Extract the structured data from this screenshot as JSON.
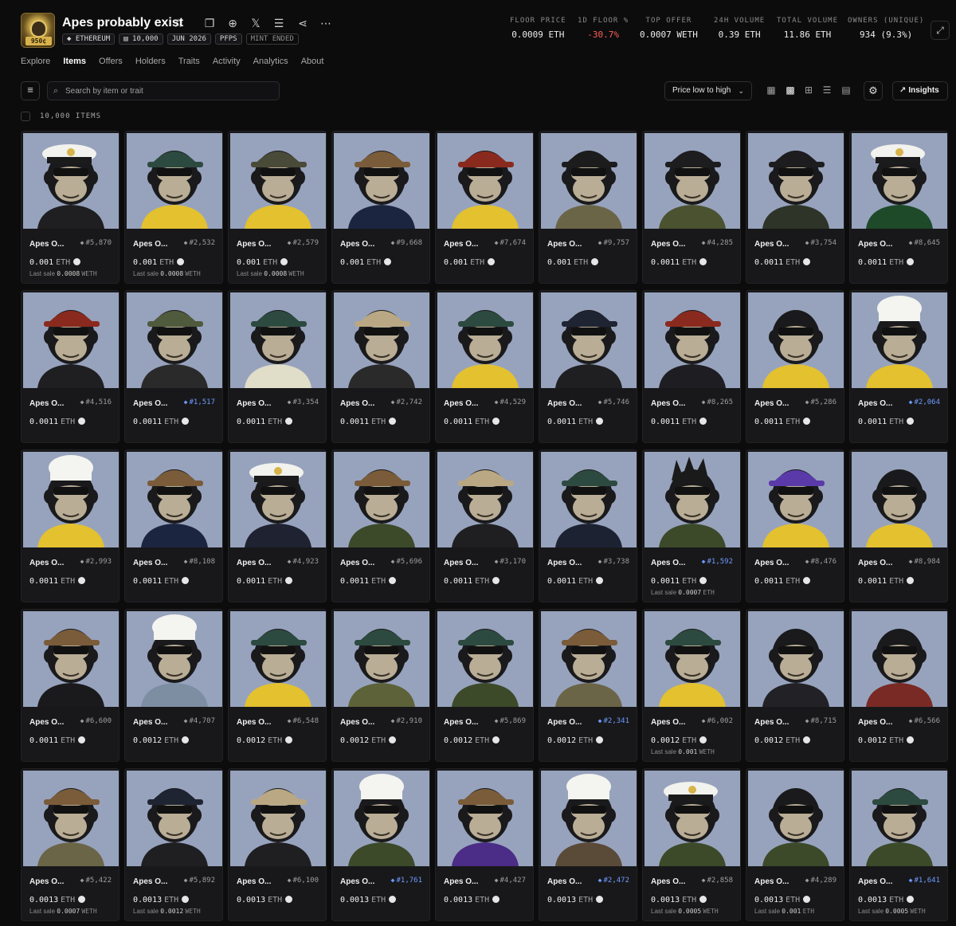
{
  "collection": {
    "name": "Apes probably exist",
    "logo_badge": "950¢",
    "tags": [
      "ETHEREUM",
      "10,000",
      "JUN 2026",
      "PFPS",
      "MINT ENDED"
    ]
  },
  "stats": [
    {
      "label": "FLOOR PRICE",
      "value": "0.0009 ETH",
      "negative": false
    },
    {
      "label": "1D FLOOR %",
      "value": "-30.7%",
      "negative": true
    },
    {
      "label": "TOP OFFER",
      "value": "0.0007 WETH",
      "negative": false
    },
    {
      "label": "24H VOLUME",
      "value": "0.39 ETH",
      "negative": false
    },
    {
      "label": "TOTAL VOLUME",
      "value": "11.86 ETH",
      "negative": false
    },
    {
      "label": "OWNERS (UNIQUE)",
      "value": "934 (9.3%)",
      "negative": false
    }
  ],
  "nav": [
    "Explore",
    "Items",
    "Offers",
    "Holders",
    "Traits",
    "Activity",
    "Analytics",
    "About"
  ],
  "nav_active": "Items",
  "search": {
    "placeholder": "Search by item or trait"
  },
  "sort": {
    "label": "Price low to high"
  },
  "insights": {
    "label": "Insights"
  },
  "items_count": "10,000 ITEMS",
  "colors": {
    "art_bg": "#97a3bd",
    "accent_blue": "#6e9bff",
    "negative": "#ff5f57"
  },
  "items": [
    {
      "name": "Apes O...",
      "token": "#5,870",
      "blue": false,
      "price": "0.001",
      "currency": "ETH",
      "last_sale": "0.0008",
      "last_cur": "WETH"
    },
    {
      "name": "Apes O...",
      "token": "#2,532",
      "blue": false,
      "price": "0.001",
      "currency": "ETH",
      "last_sale": "0.0008",
      "last_cur": "WETH"
    },
    {
      "name": "Apes O...",
      "token": "#2,579",
      "blue": false,
      "price": "0.001",
      "currency": "ETH",
      "last_sale": "0.0008",
      "last_cur": "WETH"
    },
    {
      "name": "Apes O...",
      "token": "#9,668",
      "blue": false,
      "price": "0.001",
      "currency": "ETH",
      "last_sale": "",
      "last_cur": ""
    },
    {
      "name": "Apes O...",
      "token": "#7,674",
      "blue": false,
      "price": "0.001",
      "currency": "ETH",
      "last_sale": "",
      "last_cur": ""
    },
    {
      "name": "Apes O...",
      "token": "#9,757",
      "blue": false,
      "price": "0.001",
      "currency": "ETH",
      "last_sale": "",
      "last_cur": ""
    },
    {
      "name": "Apes O...",
      "token": "#4,285",
      "blue": false,
      "price": "0.0011",
      "currency": "ETH",
      "last_sale": "",
      "last_cur": ""
    },
    {
      "name": "Apes O...",
      "token": "#3,754",
      "blue": false,
      "price": "0.0011",
      "currency": "ETH",
      "last_sale": "",
      "last_cur": ""
    },
    {
      "name": "Apes O...",
      "token": "#8,645",
      "blue": false,
      "price": "0.0011",
      "currency": "ETH",
      "last_sale": "",
      "last_cur": ""
    },
    {
      "name": "Apes O...",
      "token": "#4,516",
      "blue": false,
      "price": "0.0011",
      "currency": "ETH",
      "last_sale": "",
      "last_cur": ""
    },
    {
      "name": "Apes O...",
      "token": "#1,517",
      "blue": true,
      "price": "0.0011",
      "currency": "ETH",
      "last_sale": "",
      "last_cur": ""
    },
    {
      "name": "Apes O...",
      "token": "#3,354",
      "blue": false,
      "price": "0.0011",
      "currency": "ETH",
      "last_sale": "",
      "last_cur": ""
    },
    {
      "name": "Apes O...",
      "token": "#2,742",
      "blue": false,
      "price": "0.0011",
      "currency": "ETH",
      "last_sale": "",
      "last_cur": ""
    },
    {
      "name": "Apes O...",
      "token": "#4,529",
      "blue": false,
      "price": "0.0011",
      "currency": "ETH",
      "last_sale": "",
      "last_cur": ""
    },
    {
      "name": "Apes O...",
      "token": "#5,746",
      "blue": false,
      "price": "0.0011",
      "currency": "ETH",
      "last_sale": "",
      "last_cur": ""
    },
    {
      "name": "Apes O...",
      "token": "#8,265",
      "blue": false,
      "price": "0.0011",
      "currency": "ETH",
      "last_sale": "",
      "last_cur": ""
    },
    {
      "name": "Apes O...",
      "token": "#5,286",
      "blue": false,
      "price": "0.0011",
      "currency": "ETH",
      "last_sale": "",
      "last_cur": ""
    },
    {
      "name": "Apes O...",
      "token": "#2,064",
      "blue": true,
      "price": "0.0011",
      "currency": "ETH",
      "last_sale": "",
      "last_cur": ""
    },
    {
      "name": "Apes O...",
      "token": "#2,993",
      "blue": false,
      "price": "0.0011",
      "currency": "ETH",
      "last_sale": "",
      "last_cur": ""
    },
    {
      "name": "Apes O...",
      "token": "#8,108",
      "blue": false,
      "price": "0.0011",
      "currency": "ETH",
      "last_sale": "",
      "last_cur": ""
    },
    {
      "name": "Apes O...",
      "token": "#4,923",
      "blue": false,
      "price": "0.0011",
      "currency": "ETH",
      "last_sale": "",
      "last_cur": ""
    },
    {
      "name": "Apes O...",
      "token": "#5,696",
      "blue": false,
      "price": "0.0011",
      "currency": "ETH",
      "last_sale": "",
      "last_cur": ""
    },
    {
      "name": "Apes O...",
      "token": "#3,170",
      "blue": false,
      "price": "0.0011",
      "currency": "ETH",
      "last_sale": "",
      "last_cur": ""
    },
    {
      "name": "Apes O...",
      "token": "#3,738",
      "blue": false,
      "price": "0.0011",
      "currency": "ETH",
      "last_sale": "",
      "last_cur": ""
    },
    {
      "name": "Apes O...",
      "token": "#1,592",
      "blue": true,
      "price": "0.0011",
      "currency": "ETH",
      "last_sale": "0.0007",
      "last_cur": "ETH"
    },
    {
      "name": "Apes O...",
      "token": "#8,476",
      "blue": false,
      "price": "0.0011",
      "currency": "ETH",
      "last_sale": "",
      "last_cur": ""
    },
    {
      "name": "Apes O...",
      "token": "#8,984",
      "blue": false,
      "price": "0.0011",
      "currency": "ETH",
      "last_sale": "",
      "last_cur": ""
    },
    {
      "name": "Apes O...",
      "token": "#6,600",
      "blue": false,
      "price": "0.0011",
      "currency": "ETH",
      "last_sale": "",
      "last_cur": ""
    },
    {
      "name": "Apes O...",
      "token": "#4,707",
      "blue": false,
      "price": "0.0012",
      "currency": "ETH",
      "last_sale": "",
      "last_cur": ""
    },
    {
      "name": "Apes O...",
      "token": "#6,548",
      "blue": false,
      "price": "0.0012",
      "currency": "ETH",
      "last_sale": "",
      "last_cur": ""
    },
    {
      "name": "Apes O...",
      "token": "#2,910",
      "blue": false,
      "price": "0.0012",
      "currency": "ETH",
      "last_sale": "",
      "last_cur": ""
    },
    {
      "name": "Apes O...",
      "token": "#5,869",
      "blue": false,
      "price": "0.0012",
      "currency": "ETH",
      "last_sale": "",
      "last_cur": ""
    },
    {
      "name": "Apes O...",
      "token": "#2,341",
      "blue": true,
      "price": "0.0012",
      "currency": "ETH",
      "last_sale": "",
      "last_cur": ""
    },
    {
      "name": "Apes O...",
      "token": "#6,002",
      "blue": false,
      "price": "0.0012",
      "currency": "ETH",
      "last_sale": "0.001",
      "last_cur": "WETH"
    },
    {
      "name": "Apes O...",
      "token": "#8,715",
      "blue": false,
      "price": "0.0012",
      "currency": "ETH",
      "last_sale": "",
      "last_cur": ""
    },
    {
      "name": "Apes O...",
      "token": "#6,566",
      "blue": false,
      "price": "0.0012",
      "currency": "ETH",
      "last_sale": "",
      "last_cur": ""
    },
    {
      "name": "Apes O...",
      "token": "#5,422",
      "blue": false,
      "price": "0.0013",
      "currency": "ETH",
      "last_sale": "0.0007",
      "last_cur": "WETH"
    },
    {
      "name": "Apes O...",
      "token": "#5,892",
      "blue": false,
      "price": "0.0013",
      "currency": "ETH",
      "last_sale": "0.0012",
      "last_cur": "WETH"
    },
    {
      "name": "Apes O...",
      "token": "#6,100",
      "blue": false,
      "price": "0.0013",
      "currency": "ETH",
      "last_sale": "",
      "last_cur": ""
    },
    {
      "name": "Apes O...",
      "token": "#1,761",
      "blue": true,
      "price": "0.0013",
      "currency": "ETH",
      "last_sale": "",
      "last_cur": ""
    },
    {
      "name": "Apes O...",
      "token": "#4,427",
      "blue": false,
      "price": "0.0013",
      "currency": "ETH",
      "last_sale": "",
      "last_cur": ""
    },
    {
      "name": "Apes O...",
      "token": "#2,472",
      "blue": true,
      "price": "0.0013",
      "currency": "ETH",
      "last_sale": "",
      "last_cur": ""
    },
    {
      "name": "Apes O...",
      "token": "#2,858",
      "blue": false,
      "price": "0.0013",
      "currency": "ETH",
      "last_sale": "0.0005",
      "last_cur": "WETH"
    },
    {
      "name": "Apes O...",
      "token": "#4,289",
      "blue": false,
      "price": "0.0013",
      "currency": "ETH",
      "last_sale": "0.001",
      "last_cur": "ETH"
    },
    {
      "name": "Apes O...",
      "token": "#1,641",
      "blue": true,
      "price": "0.0013",
      "currency": "ETH",
      "last_sale": "0.0005",
      "last_cur": "WETH"
    }
  ],
  "last_sale_label": "Last sale"
}
